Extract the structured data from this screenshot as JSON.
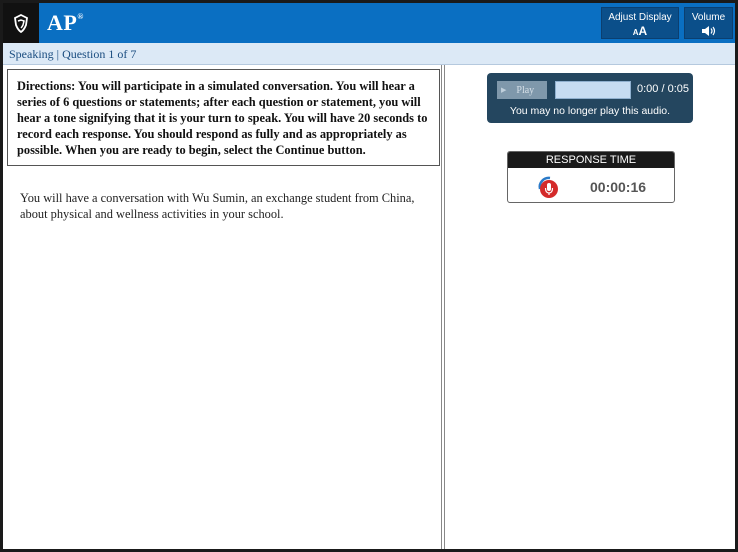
{
  "header": {
    "brand": "AP",
    "brand_mark": "®",
    "logo_icon": "college-board-acorn-icon",
    "adjust_display_label": "Adjust Display",
    "adjust_display_icon": "font-size-icon",
    "adjust_display_glyph": "AA",
    "volume_label": "Volume",
    "volume_icon": "speaker-icon",
    "volume_glyph": "◀)))"
  },
  "subheader": {
    "section": "Speaking | Question 1 of 7"
  },
  "left": {
    "directions": "Directions: You will participate in a simulated conversation. You will hear a series of 6 questions or statements; after each question or statement, you will hear a tone signifying that it is your turn to speak. You will have 20 seconds to record each response. You should respond as fully and as appropriately as possible. When you are ready to begin, select the Continue button.",
    "prompt": "You will have a conversation with Wu Sumin, an exchange student from China, about physical and wellness activities in your school."
  },
  "player": {
    "play_label": "Play",
    "play_icon": "play-icon",
    "progress": 0,
    "time": "0:00 / 0:05",
    "message": "You may no longer play this audio."
  },
  "response": {
    "title": "RESPONSE TIME",
    "mic_icon": "microphone-icon",
    "time": "00:00:16"
  },
  "colors": {
    "header_bg": "#0a6fc2",
    "subheader_bg": "#dce9f6",
    "player_bg": "#24465f",
    "mic_red": "#d42a2a"
  }
}
